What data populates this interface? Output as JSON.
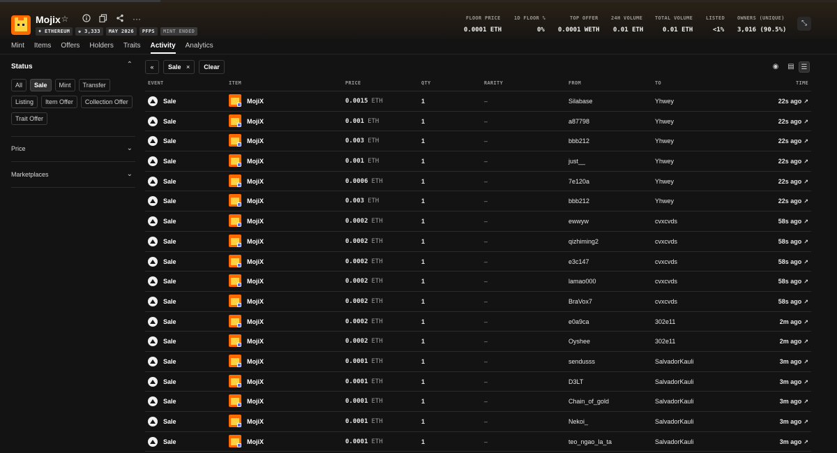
{
  "collection": {
    "name": "Mojix",
    "chips": [
      "♦ ETHEREUM",
      "♚ 3,333",
      "MAY 2026",
      "PFPS",
      "MINT ENDED"
    ],
    "icons": [
      "star-icon",
      "info-icon",
      "copy-icon",
      "share-icon",
      "more-icon"
    ]
  },
  "stats": [
    {
      "label": "FLOOR PRICE",
      "value": "0.0001 ETH"
    },
    {
      "label": "1D FLOOR %",
      "value": "0%"
    },
    {
      "label": "TOP OFFER",
      "value": "0.0001 WETH"
    },
    {
      "label": "24H VOLUME",
      "value": "0.01 ETH"
    },
    {
      "label": "TOTAL VOLUME",
      "value": "0.01 ETH"
    },
    {
      "label": "LISTED",
      "value": "<1%"
    },
    {
      "label": "OWNERS (UNIQUE)",
      "value": "3,016 (90.5%)"
    }
  ],
  "tabs": [
    "Mint",
    "Items",
    "Offers",
    "Holders",
    "Traits",
    "Activity",
    "Analytics"
  ],
  "active_tab": "Activity",
  "sidebar": {
    "status_title": "Status",
    "status_filters": [
      "All",
      "Sale",
      "Mint",
      "Transfer",
      "Listing",
      "Item Offer",
      "Collection Offer",
      "Trait Offer"
    ],
    "active_filter": "Sale",
    "price_title": "Price",
    "marketplaces_title": "Marketplaces"
  },
  "toolbar": {
    "active_chip": "Sale",
    "clear_label": "Clear"
  },
  "table": {
    "headers": [
      "EVENT",
      "ITEM",
      "PRICE",
      "QTY",
      "RARITY",
      "FROM",
      "TO",
      "TIME"
    ],
    "rows": [
      {
        "event": "Sale",
        "item": "MojiX",
        "price": "0.0015",
        "unit": "ETH",
        "qty": "1",
        "rarity": "–",
        "from": "Silabase",
        "to": "Yhwey",
        "time": "22s ago"
      },
      {
        "event": "Sale",
        "item": "MojiX",
        "price": "0.001",
        "unit": "ETH",
        "qty": "1",
        "rarity": "–",
        "from": "a87798",
        "to": "Yhwey",
        "time": "22s ago"
      },
      {
        "event": "Sale",
        "item": "MojiX",
        "price": "0.003",
        "unit": "ETH",
        "qty": "1",
        "rarity": "–",
        "from": "bbb212",
        "to": "Yhwey",
        "time": "22s ago"
      },
      {
        "event": "Sale",
        "item": "MojiX",
        "price": "0.001",
        "unit": "ETH",
        "qty": "1",
        "rarity": "–",
        "from": "just__",
        "to": "Yhwey",
        "time": "22s ago"
      },
      {
        "event": "Sale",
        "item": "MojiX",
        "price": "0.0006",
        "unit": "ETH",
        "qty": "1",
        "rarity": "–",
        "from": "7e120a",
        "to": "Yhwey",
        "time": "22s ago"
      },
      {
        "event": "Sale",
        "item": "MojiX",
        "price": "0.003",
        "unit": "ETH",
        "qty": "1",
        "rarity": "–",
        "from": "bbb212",
        "to": "Yhwey",
        "time": "22s ago"
      },
      {
        "event": "Sale",
        "item": "MojiX",
        "price": "0.0002",
        "unit": "ETH",
        "qty": "1",
        "rarity": "–",
        "from": "ewwyw",
        "to": "cvxcvds",
        "time": "58s ago"
      },
      {
        "event": "Sale",
        "item": "MojiX",
        "price": "0.0002",
        "unit": "ETH",
        "qty": "1",
        "rarity": "–",
        "from": "qizhiming2",
        "to": "cvxcvds",
        "time": "58s ago"
      },
      {
        "event": "Sale",
        "item": "MojiX",
        "price": "0.0002",
        "unit": "ETH",
        "qty": "1",
        "rarity": "–",
        "from": "e3c147",
        "to": "cvxcvds",
        "time": "58s ago"
      },
      {
        "event": "Sale",
        "item": "MojiX",
        "price": "0.0002",
        "unit": "ETH",
        "qty": "1",
        "rarity": "–",
        "from": "lamao000",
        "to": "cvxcvds",
        "time": "58s ago"
      },
      {
        "event": "Sale",
        "item": "MojiX",
        "price": "0.0002",
        "unit": "ETH",
        "qty": "1",
        "rarity": "–",
        "from": "BraVox7",
        "to": "cvxcvds",
        "time": "58s ago"
      },
      {
        "event": "Sale",
        "item": "MojiX",
        "price": "0.0002",
        "unit": "ETH",
        "qty": "1",
        "rarity": "–",
        "from": "e0a9ca",
        "to": "302e11",
        "time": "2m ago"
      },
      {
        "event": "Sale",
        "item": "MojiX",
        "price": "0.0002",
        "unit": "ETH",
        "qty": "1",
        "rarity": "–",
        "from": "Oyshee",
        "to": "302e11",
        "time": "2m ago"
      },
      {
        "event": "Sale",
        "item": "MojiX",
        "price": "0.0001",
        "unit": "ETH",
        "qty": "1",
        "rarity": "–",
        "from": "sendusss",
        "to": "SalvadorKauli",
        "time": "3m ago"
      },
      {
        "event": "Sale",
        "item": "MojiX",
        "price": "0.0001",
        "unit": "ETH",
        "qty": "1",
        "rarity": "–",
        "from": "D3LT",
        "to": "SalvadorKauli",
        "time": "3m ago"
      },
      {
        "event": "Sale",
        "item": "MojiX",
        "price": "0.0001",
        "unit": "ETH",
        "qty": "1",
        "rarity": "–",
        "from": "Chain_of_gold",
        "to": "SalvadorKauli",
        "time": "3m ago"
      },
      {
        "event": "Sale",
        "item": "MojiX",
        "price": "0.0001",
        "unit": "ETH",
        "qty": "1",
        "rarity": "–",
        "from": "Nekoi_",
        "to": "SalvadorKauli",
        "time": "3m ago"
      },
      {
        "event": "Sale",
        "item": "MojiX",
        "price": "0.0001",
        "unit": "ETH",
        "qty": "1",
        "rarity": "–",
        "from": "teo_ngao_la_ta",
        "to": "SalvadorKauli",
        "time": "3m ago"
      }
    ]
  }
}
